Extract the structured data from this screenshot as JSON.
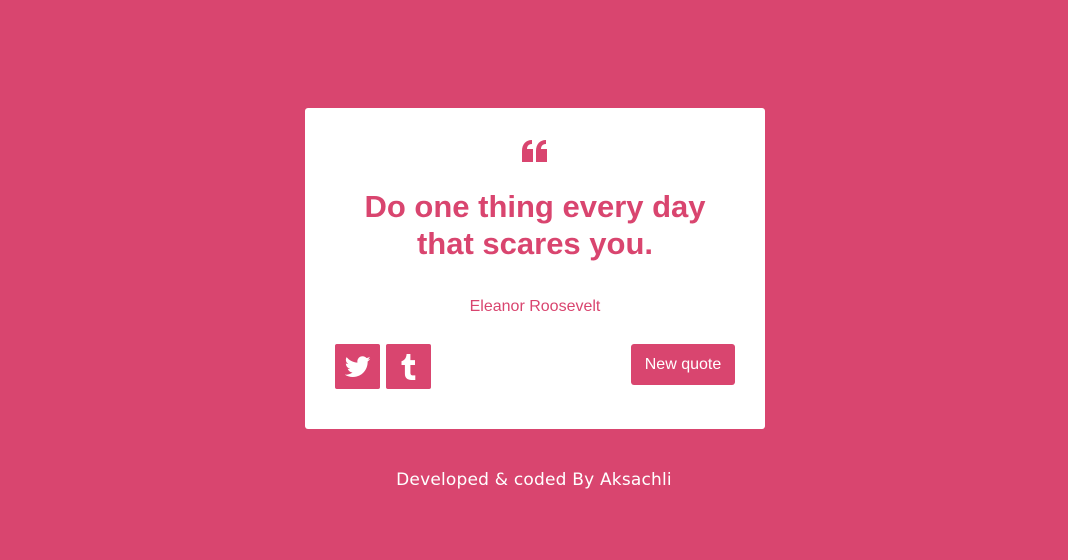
{
  "colors": {
    "accent": "#d9456f",
    "card": "#ffffff",
    "text_on_accent": "#ffffff"
  },
  "quote": {
    "icon": "quote-left-icon",
    "text": "Do one thing every day that scares you.",
    "author": "Eleanor Roosevelt"
  },
  "actions": {
    "share": [
      {
        "icon": "twitter-icon"
      },
      {
        "icon": "tumblr-icon"
      }
    ],
    "new_quote_label": "New quote"
  },
  "footer": {
    "text": "Developed & coded By Aksachli"
  }
}
